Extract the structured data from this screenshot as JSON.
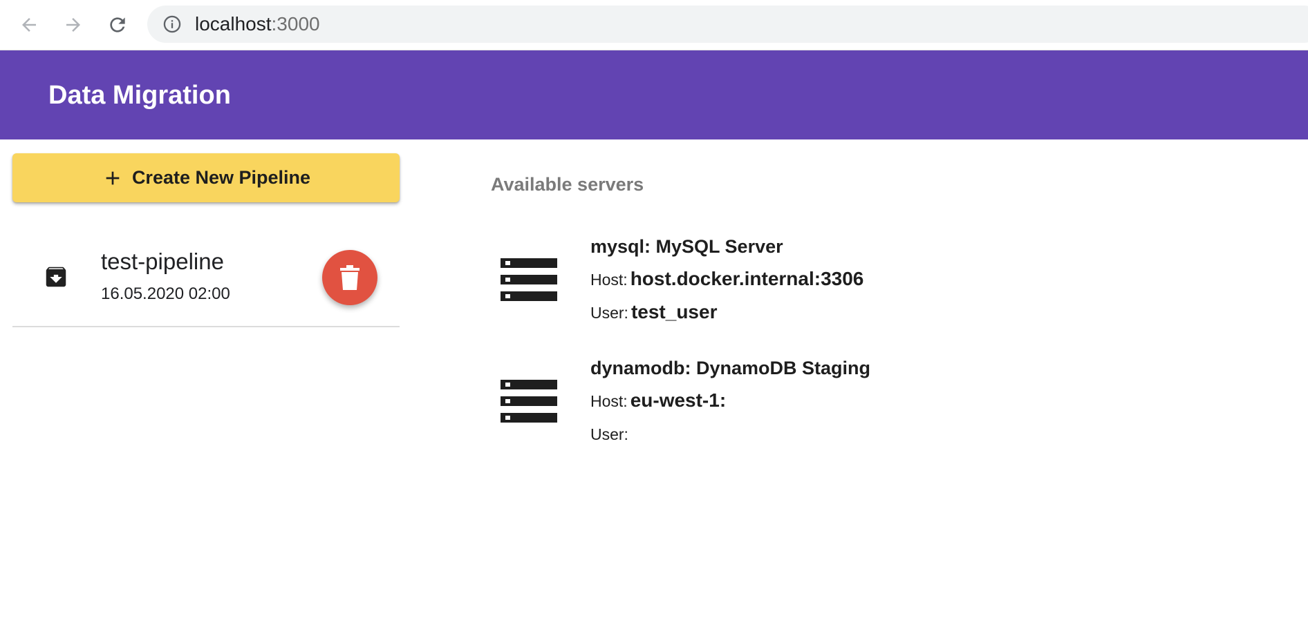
{
  "browser": {
    "url_host": "localhost",
    "url_port": ":3000"
  },
  "app": {
    "title": "Data Migration"
  },
  "sidebar": {
    "create_label": "Create New Pipeline",
    "pipelines": [
      {
        "name": "test-pipeline",
        "date": "16.05.2020 02:00"
      }
    ]
  },
  "servers": {
    "heading": "Available servers",
    "host_label": "Host:",
    "user_label": "User:",
    "items": [
      {
        "title": "mysql: MySQL Server",
        "host": "host.docker.internal:3306",
        "user": "test_user"
      },
      {
        "title": "dynamodb: DynamoDB Staging",
        "host": "eu-west-1:",
        "user": ""
      }
    ]
  },
  "icons": {
    "back": "arrow-left-icon",
    "forward": "arrow-right-icon",
    "reload": "reload-icon",
    "info": "info-icon",
    "plus": "plus-icon",
    "archive": "archive-icon",
    "trash": "trash-icon",
    "server": "server-icon"
  },
  "colors": {
    "app_bar": "#6244b2",
    "create_button": "#f9d55e",
    "delete_button": "#e15241"
  }
}
